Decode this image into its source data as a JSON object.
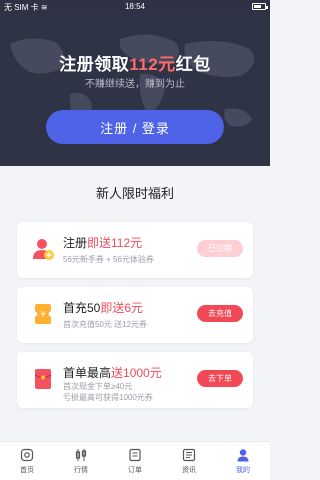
{
  "status": {
    "carrier": "无 SIM 卡",
    "time": "18:54",
    "battery_level": 0.6
  },
  "hero": {
    "title_prefix": "注册领取",
    "title_amount": "112元",
    "title_suffix": "红包",
    "subtitle": "不赚继续送，赚到为止",
    "login_button": "注册 / 登录"
  },
  "section": {
    "title": "新人限时福利"
  },
  "cards": [
    {
      "title_prefix": "注册",
      "title_highlight": "即送112元",
      "desc_lines": [
        "56元新手券 + 56元体验券"
      ],
      "button": "已过期",
      "icon": "user-plus-icon"
    },
    {
      "title_prefix": "首充50",
      "title_highlight": "即送6元",
      "desc_lines": [
        "首次充值50元 送12元券"
      ],
      "button": "去充值",
      "icon": "coupon-icon"
    },
    {
      "title_prefix": "首单最高",
      "title_highlight": "送1000元",
      "desc_lines": [
        "首次现金下单≥40元",
        "亏损最高可获得1000元券"
      ],
      "button": "去下单",
      "icon": "red-envelope-icon"
    }
  ],
  "tabbar": {
    "items": [
      {
        "label": "首页",
        "icon": "home-icon"
      },
      {
        "label": "行情",
        "icon": "candlestick-icon"
      },
      {
        "label": "订单",
        "icon": "order-icon"
      },
      {
        "label": "资讯",
        "icon": "news-icon"
      },
      {
        "label": "我的",
        "icon": "profile-icon"
      }
    ],
    "active_index": 4
  },
  "colors": {
    "hero_bg": "#2f3346",
    "accent_blue": "#4f63e8",
    "accent_red": "#f24957",
    "disabled_pill": "#fdcfd3"
  }
}
